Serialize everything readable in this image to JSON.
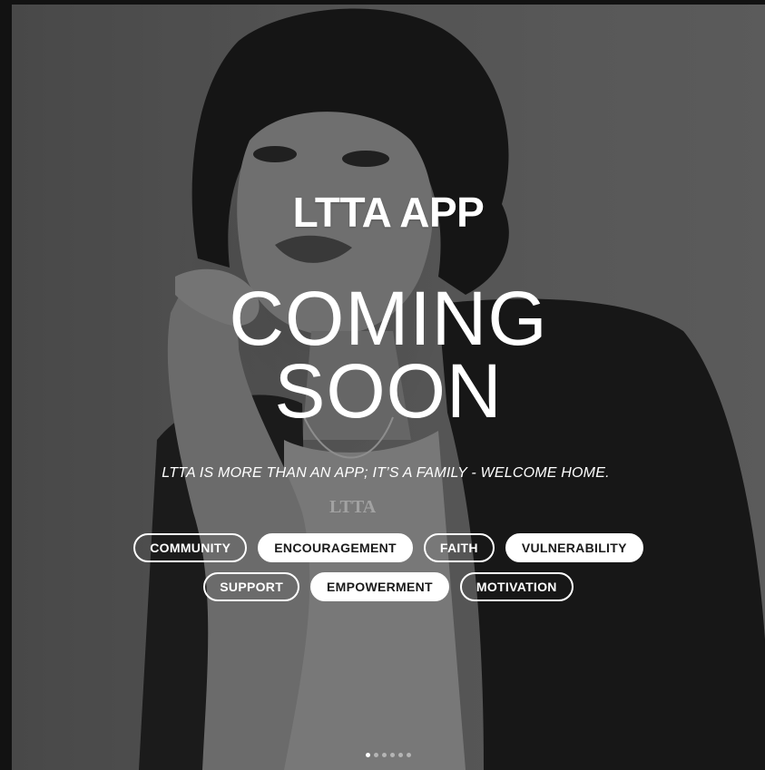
{
  "slide": {
    "app_title": "LTTA APP",
    "headline_line1": "COMING",
    "headline_line2": "SOON",
    "tagline": "LTTA  IS MORE THAN AN APP; IT’S A FAMILY - WELCOME HOME.",
    "necklace_text": "LTTA"
  },
  "chips_row1": [
    {
      "label": "COMMUNITY",
      "style": "outline"
    },
    {
      "label": "ENCOURAGEMENT",
      "style": "filled"
    },
    {
      "label": "FAITH",
      "style": "outline"
    },
    {
      "label": "VULNERABILITY",
      "style": "filled"
    }
  ],
  "chips_row2": [
    {
      "label": "SUPPORT",
      "style": "outline"
    },
    {
      "label": "EMPOWERMENT",
      "style": "filled"
    },
    {
      "label": "MOTIVATION",
      "style": "outline"
    }
  ],
  "carousel": {
    "total": 6,
    "active_index": 0
  },
  "colors": {
    "text": "#ffffff",
    "chip_fill": "#ffffff",
    "chip_fill_text": "#1a1a1a",
    "page_background": "#121212"
  }
}
